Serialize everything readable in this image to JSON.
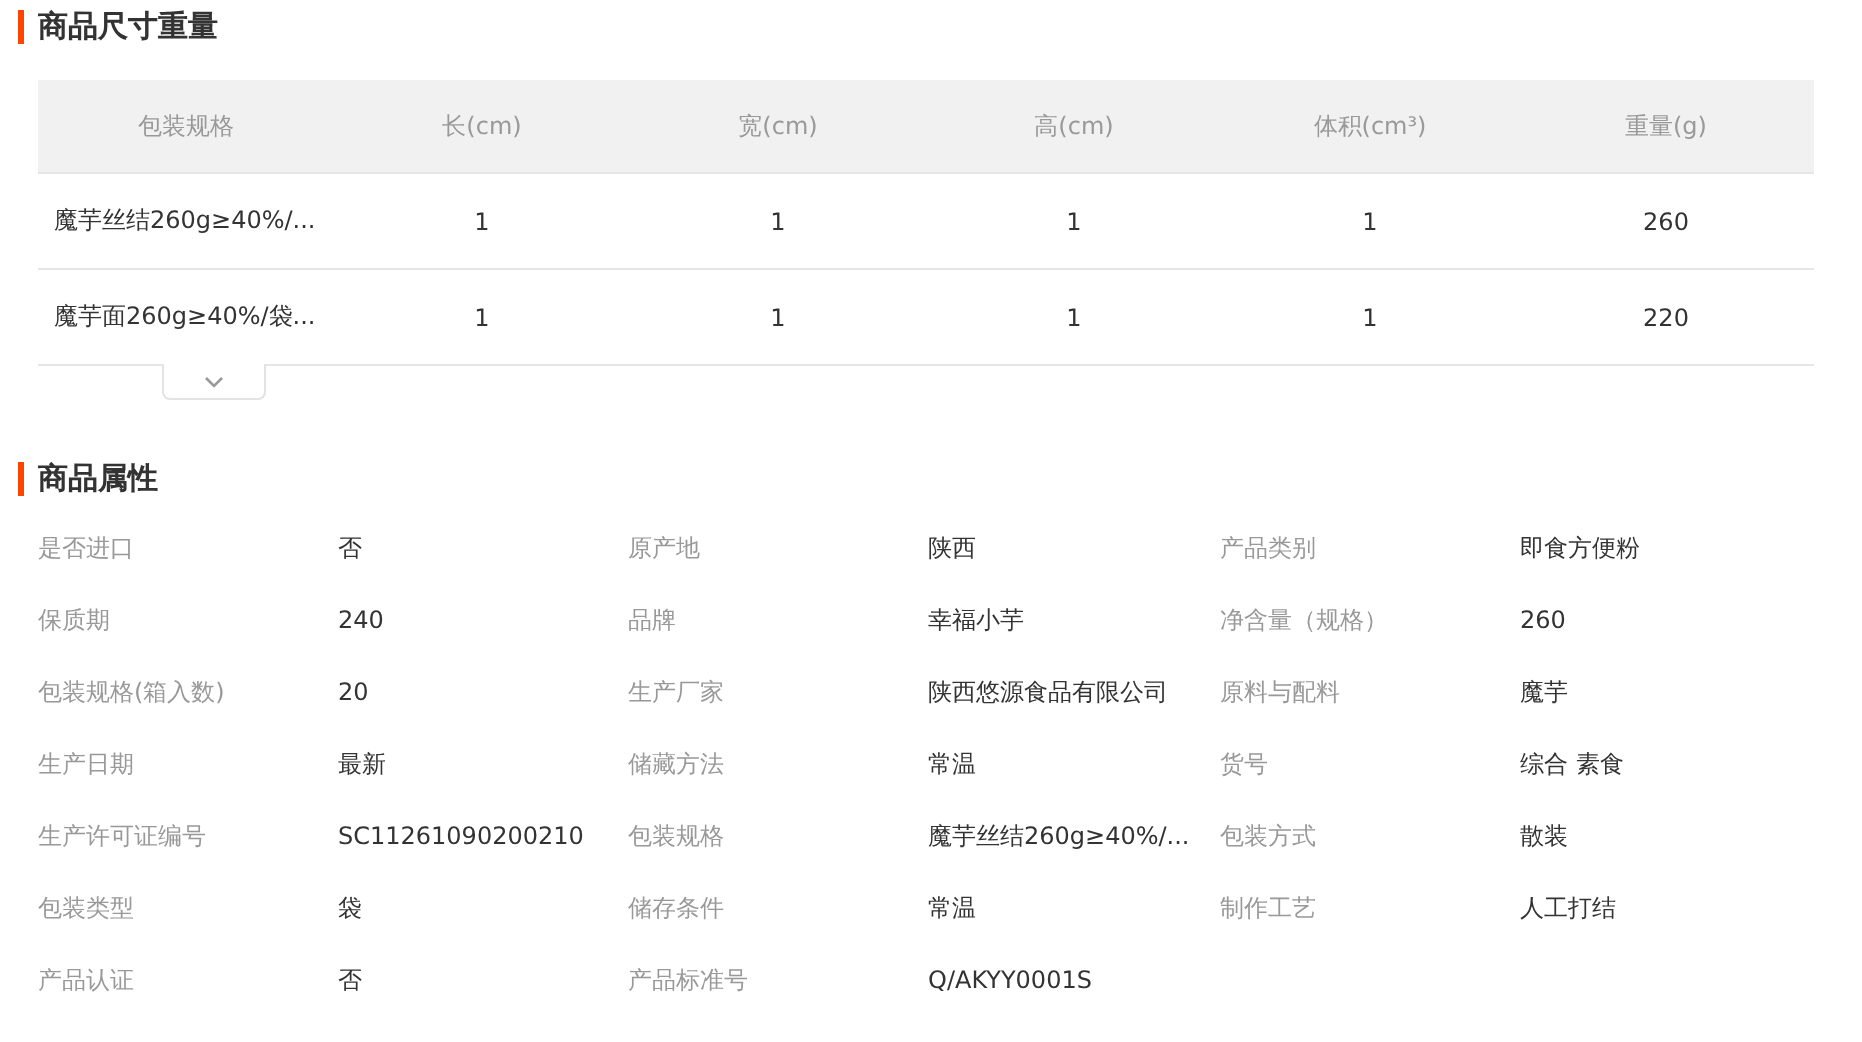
{
  "size_weight": {
    "title": "商品尺寸重量",
    "columns": [
      "包装规格",
      "长(cm)",
      "宽(cm)",
      "高(cm)",
      "体积(cm³)",
      "重量(g)"
    ],
    "rows": [
      [
        "魔芋丝结260g≥40%/...",
        "1",
        "1",
        "1",
        "1",
        "260"
      ],
      [
        "魔芋面260g≥40%/袋...",
        "1",
        "1",
        "1",
        "1",
        "220"
      ]
    ]
  },
  "attributes": {
    "title": "商品属性",
    "items": [
      {
        "label": "是否进口",
        "value": "否"
      },
      {
        "label": "原产地",
        "value": "陕西"
      },
      {
        "label": "产品类别",
        "value": "即食方便粉"
      },
      {
        "label": "保质期",
        "value": "240"
      },
      {
        "label": "品牌",
        "value": "幸福小芋"
      },
      {
        "label": "净含量（规格）",
        "value": "260"
      },
      {
        "label": "包装规格(箱入数)",
        "value": "20"
      },
      {
        "label": "生产厂家",
        "value": "陕西悠源食品有限公司"
      },
      {
        "label": "原料与配料",
        "value": "魔芋"
      },
      {
        "label": "生产日期",
        "value": "最新"
      },
      {
        "label": "储藏方法",
        "value": "常温"
      },
      {
        "label": "货号",
        "value": "综合 素食"
      },
      {
        "label": "生产许可证编号",
        "value": "SC11261090200210"
      },
      {
        "label": "包装规格",
        "value": "魔芋丝结260g≥40%/..."
      },
      {
        "label": "包装方式",
        "value": "散装"
      },
      {
        "label": "包装类型",
        "value": "袋"
      },
      {
        "label": "储存条件",
        "value": "常温"
      },
      {
        "label": "制作工艺",
        "value": "人工打结"
      },
      {
        "label": "产品认证",
        "value": "否"
      },
      {
        "label": "产品标准号",
        "value": "Q/AKYY0001S"
      }
    ]
  }
}
